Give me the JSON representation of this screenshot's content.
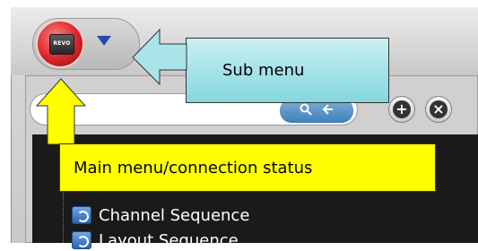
{
  "window": {
    "main_menu_orb": {
      "label": "REVO",
      "icon": "revo-logo-icon",
      "color": "#d8262b"
    },
    "submenu_button": {
      "icon": "chevron-down-icon",
      "color": "#2a49a8"
    }
  },
  "toolbar": {
    "search_input": {
      "value": "",
      "placeholder": ""
    },
    "search_button_icons": [
      "search-icon",
      "back-arrow-icon"
    ],
    "add_button_icon": "plus-icon",
    "close_button_icon": "close-icon"
  },
  "tree": {
    "items": [
      {
        "label": "Channel Sequence",
        "icon": "channel-sequence-icon"
      },
      {
        "label": "Layout Sequence",
        "icon": "layout-sequence-icon"
      }
    ]
  },
  "annotations": {
    "sub_menu": "Sub menu",
    "main_menu": "Main menu/connection status",
    "sub_menu_color": "#9ee0e5",
    "main_menu_color": "#ffff00"
  }
}
